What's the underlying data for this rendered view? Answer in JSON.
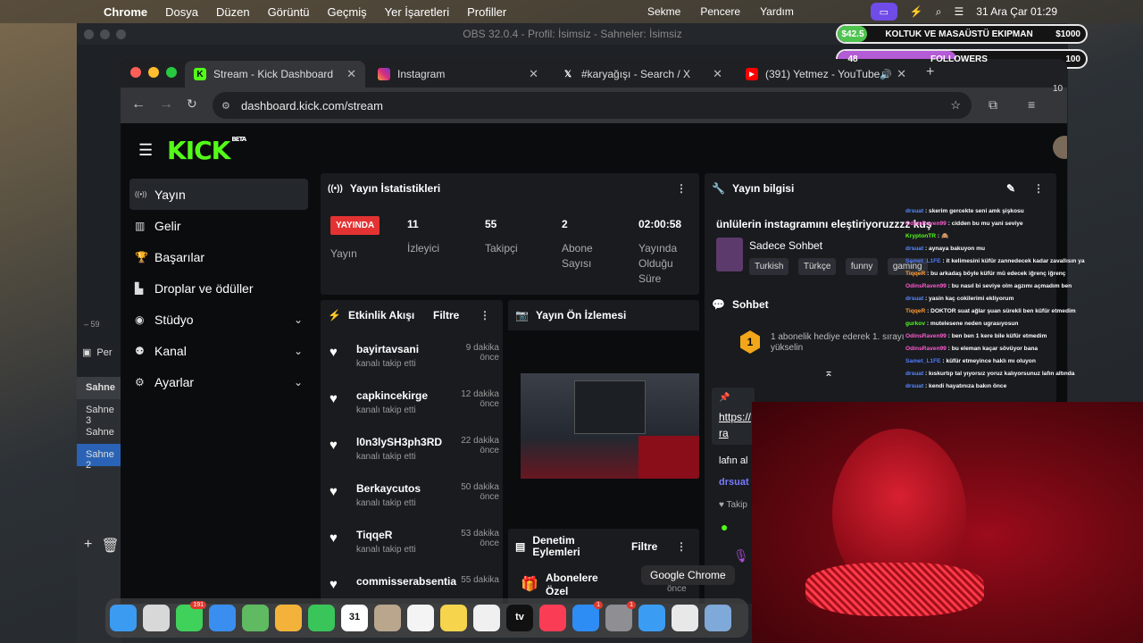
{
  "menubar": {
    "app_name": "Chrome",
    "items": [
      "Dosya",
      "Düzen",
      "Görüntü",
      "Geçmiş",
      "Yer İşaretleri",
      "Profiller"
    ],
    "right_items": [
      "Sekme",
      "Pencere",
      "Yardım"
    ],
    "clock": "31 Ara Çar  01:29"
  },
  "obs": {
    "title": "OBS 32.0.4 - Profil: İsimsiz - Sahneler: İsimsiz",
    "scenes_header": "Sahne",
    "scenes": [
      "Sahne 3",
      "Sahne",
      "Sahne 2"
    ],
    "partial_label": "Per",
    "zoom": "59"
  },
  "goals": [
    {
      "left": "$42.5",
      "label": "KOLTUK VE MASAÜSTÜ EKIPMAN",
      "right": "$1000",
      "progress": 0.0425,
      "color": "#4fc34f"
    },
    {
      "left": "48",
      "label": "FOLLOWERS",
      "right": "100",
      "progress": 0.48,
      "color": "#b45bd6"
    }
  ],
  "browser": {
    "tabs": [
      {
        "title": "Stream - Kick Dashboard",
        "active": true,
        "icon": "kick-icon"
      },
      {
        "title": "Instagram",
        "active": false,
        "icon": "instagram-icon"
      },
      {
        "title": "#karyağışı - Search / X",
        "active": false,
        "icon": "x-icon"
      },
      {
        "title": "(391) Yetmez - YouTube",
        "active": false,
        "icon": "youtube-icon"
      }
    ],
    "url": "dashboard.kick.com/stream",
    "ext_count": "10"
  },
  "kick": {
    "logo": "KICK",
    "beta": "BETA",
    "nav": [
      {
        "label": "Yayın",
        "icon": "broadcast-icon",
        "selected": true
      },
      {
        "label": "Gelir",
        "icon": "chart-icon",
        "selected": false
      },
      {
        "label": "Başarılar",
        "icon": "trophy-icon",
        "selected": false
      },
      {
        "label": "Droplar ve ödüller",
        "icon": "gift-icon",
        "selected": false
      },
      {
        "label": "Stüdyo",
        "icon": "studio-icon",
        "selected": false,
        "expand": true
      },
      {
        "label": "Kanal",
        "icon": "channel-icon",
        "selected": false,
        "expand": true
      },
      {
        "label": "Ayarlar",
        "icon": "settings-icon",
        "selected": false,
        "expand": true
      }
    ],
    "stats": {
      "title": "Yayın İstatistikleri",
      "live_badge": "YAYINDA",
      "live_label": "Yayın",
      "viewers": "11",
      "viewers_label": "İzleyici",
      "followers": "55",
      "followers_label": "Takipçi",
      "subs": "2",
      "subs_label": "Abone Sayısı",
      "uptime": "02:00:58",
      "uptime_label": "Yayında Olduğu Süre"
    },
    "info": {
      "title": "Yayın bilgisi",
      "stream_title": "ünlülerin instagramını eleştiriyoruzzzz kuş",
      "category": "Sadece Sohbet",
      "tags": [
        "Turkish",
        "Türkçe",
        "funny",
        "gaming"
      ]
    },
    "activity": {
      "title": "Etkinlik Akışı",
      "filter": "Filtre",
      "events": [
        {
          "name": "bayirtavsani",
          "action": "kanalı takip etti",
          "time": "9 dakika önce"
        },
        {
          "name": "capkincekirge",
          "action": "kanalı takip etti",
          "time": "12 dakika önce"
        },
        {
          "name": "l0n3lySH3ph3RD",
          "action": "kanalı takip etti",
          "time": "22 dakika önce"
        },
        {
          "name": "Berkaycutos",
          "action": "kanalı takip etti",
          "time": "50 dakika önce"
        },
        {
          "name": "TiqqeR",
          "action": "kanalı takip etti",
          "time": "53 dakika önce"
        },
        {
          "name": "commisserabsentia",
          "action": "",
          "time": "55 dakika"
        }
      ]
    },
    "preview": {
      "title": "Yayın Ön İzlemesi"
    },
    "moderation": {
      "title": "Denetim Eylemleri",
      "filter": "Filtre",
      "item": "Abonelere Özel",
      "time": "önce"
    },
    "chat": {
      "title": "Sohbet",
      "gift_text": "1 abonelik hediye ederek 1. sırayı yükselin",
      "gift_rank": "1",
      "link": "https://",
      "link2": "ra",
      "snippet": "lafın al",
      "user": "drsuat",
      "follow": "Takip"
    }
  },
  "chat_overlay": [
    {
      "user": "drsuat",
      "color": "#5b8bff",
      "msg": "skerim gercekte seni amk şişkosu"
    },
    {
      "user": "OdinsRaven99",
      "color": "#ff5ad0",
      "msg": "cidden bu mu yani seviye"
    },
    {
      "user": "KryptonTR",
      "color": "#53fc18",
      "msg": "🙈"
    },
    {
      "user": "drsuat",
      "color": "#5b8bff",
      "msg": "aynaya bakuyon mu"
    },
    {
      "user": "Samet_L1FE",
      "color": "#4f7bff",
      "msg": "it kelimesini küfür zannedecek kadar zavallısın ya"
    },
    {
      "user": "TiqqeR",
      "color": "#ff9c33",
      "msg": "bu arkadaş böyle küfür mü edecek iğrenç iğrenç"
    },
    {
      "user": "OdinsRaven99",
      "color": "#ff5ad0",
      "msg": "bu nasıl bi seviye olm agzımı açmadım ben"
    },
    {
      "user": "drsuat",
      "color": "#5b8bff",
      "msg": "yasin kaç cokilerimi ekliyorum"
    },
    {
      "user": "TiqqeR",
      "color": "#ff9c33",
      "msg": "DOKTOR suat ağlar şuan sürekli ben küfür etmedim"
    },
    {
      "user": "gurkov",
      "color": "#53fc18",
      "msg": "mutelesene neden ugrasıyosun"
    },
    {
      "user": "OdinsRaven99",
      "color": "#ff5ad0",
      "msg": "ben ben 1 kere bile küfür etmedim"
    },
    {
      "user": "OdinsRaven99",
      "color": "#ff5ad0",
      "msg": "bu eleman kaçar sövüyor bana"
    },
    {
      "user": "Samet_L1FE",
      "color": "#4f7bff",
      "msg": "küfür etmeyince haklı mı oluyon"
    },
    {
      "user": "drsuat",
      "color": "#5b8bff",
      "msg": "kıskurtıp tal yıyorsız yoruz kalıyorsunuz lafın altında"
    },
    {
      "user": "drsuat",
      "color": "#5b8bff",
      "msg": "kendi hayatınıza bakın önce"
    }
  ],
  "dock": {
    "tooltip": "Google Chrome",
    "apps": [
      {
        "name": "finder-icon",
        "color": "#3b9bf0"
      },
      {
        "name": "launchpad-icon",
        "color": "#d8d8d8"
      },
      {
        "name": "messages-icon",
        "color": "#3fd15a",
        "badge": "191"
      },
      {
        "name": "mail-icon",
        "color": "#3a8ef0"
      },
      {
        "name": "maps-icon",
        "color": "#5fba62"
      },
      {
        "name": "photos-icon",
        "color": "#f3b33a"
      },
      {
        "name": "facetime-icon",
        "color": "#39c55a"
      },
      {
        "name": "calendar-icon",
        "color": "#ffffff",
        "text": "31"
      },
      {
        "name": "contacts-icon",
        "color": "#b9a68c"
      },
      {
        "name": "reminders-icon",
        "color": "#f4f4f4"
      },
      {
        "name": "notes-icon",
        "color": "#f6d44c"
      },
      {
        "name": "freeform-icon",
        "color": "#f0f0f0"
      },
      {
        "name": "appletv-icon",
        "color": "#111111",
        "text": "tv"
      },
      {
        "name": "music-icon",
        "color": "#fa3c55"
      },
      {
        "name": "appstore-icon",
        "color": "#2e8cf5",
        "badge": "1"
      },
      {
        "name": "system-settings-icon",
        "color": "#8e8e93",
        "badge": "1"
      },
      {
        "name": "safari-icon",
        "color": "#3a9cf3"
      },
      {
        "name": "chrome-icon",
        "color": "#e8e8e8"
      },
      {
        "name": "preview-icon",
        "color": "#7fa9d9"
      }
    ]
  }
}
